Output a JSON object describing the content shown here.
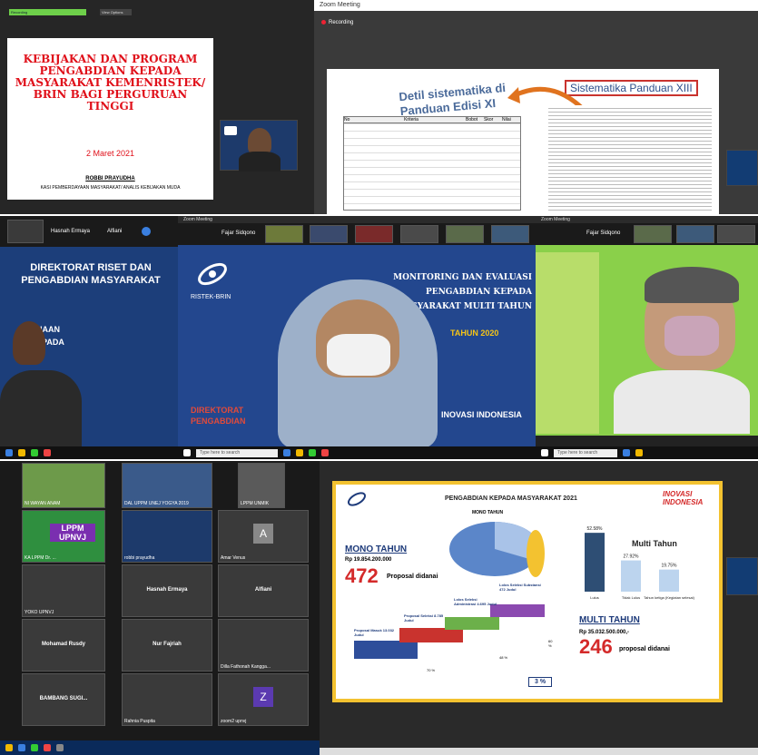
{
  "p1": {
    "topbtn1": "Recording",
    "topbtn2": "View Options",
    "title": "KEBIJAKAN DAN PROGRAM PENGABDIAN KEPADA MASYARAKAT KEMENRISTEK/ BRIN BAGI PERGURUAN TINGGI",
    "date": "2 Maret 2021",
    "presenter": "ROBBI PRAYUDHA",
    "role": "KASI PEMBERDAYAAN MASYARAKAT/ ANALIS KEBIJAKAN MUDA"
  },
  "p2": {
    "zoom_title": "Zoom Meeting",
    "recording": "Recording",
    "callout_left": "Detil sistematika di Panduan Edisi XI",
    "callout_right": "Sistematika Panduan XIII",
    "table_headers": [
      "No",
      "Kriteria",
      "Bobot",
      "Skor",
      "Nilai"
    ]
  },
  "p3": {
    "tile1": "Hasnah Ermaya",
    "tile2": "Alfiani",
    "banner": "DIREKTORAT RISET DAN PENGABDIAN MASYARAKAT",
    "side": "NAAN EPADA"
  },
  "p4": {
    "zoom_title": "Zoom Meeting",
    "presenter": "Fajar Sidqono",
    "slide_title": "MONITORING DAN EVALUASI PENGABDIAN KEPADA MASYARAKAT MULTI TAHUN",
    "year": "TAHUN 2020",
    "brand": "RISTEK-BRIN",
    "footer_left": "DIREKTORAT PENGABDIAN",
    "footer_right": "INOVASI INDONESIA",
    "search": "Type here to search"
  },
  "p5": {
    "zoom_title": "Zoom Meeting",
    "presenter": "Fajar Sidqono",
    "search": "Type here to search"
  },
  "p6": {
    "names": [
      "NI WAYAN ANAM",
      "DAL UPPM UNEJ YOGYA 2019",
      "LPPM UNMIK",
      "KA LPPM Dr. ...",
      "robbi prayudha",
      "Amar Venus",
      "YOKO UPNVJ",
      "Hasnah Ermaya",
      "Alfiani",
      "Mohamad Rusdy",
      "Nur Fajriah",
      "Dilla Fathonah Kangga...",
      "BAMBANG SUGI...",
      "Rahnia Puspita",
      "zoom2 upnvj"
    ],
    "letters": [
      "A",
      "Z"
    ],
    "lppm": "LPPM UPNVJ"
  },
  "p7": {
    "title": "PENGABDIAN KEPADA MASYARAKAT 2021",
    "brand": "INOVASI INDONESIA",
    "mono_title": "MONO TAHUN",
    "mono_amount": "Rp 19.854.200.000",
    "mono_count": "472",
    "mono_label": "Proposal didanai",
    "multi_title": "MULTI TAHUN",
    "multi_amount": "Rp 35.032.500.000,-",
    "multi_count": "246",
    "multi_label": "proposal didanai",
    "funnel": [
      "Proposal Masuk 13.032 Judul",
      "Proposal Seleksi 8.785 Judul",
      "Lolos Seleksi Administrasi 4.695 Judul",
      "Lolos Seleksi Substansi 472 Judul"
    ],
    "funnel_pcts": [
      "70 %",
      "48 %",
      "60 %",
      "3 %"
    ],
    "pie_title": "MONO TAHUN"
  },
  "chart_data": {
    "type": "bar",
    "title": "Multi Tahun",
    "categories": [
      "Lulus",
      "Tidak Lulus",
      "Tahun ketiga (Kegiatan selesai)"
    ],
    "values": [
      52.58,
      27.92,
      19.75
    ],
    "value_labels": [
      "52.58%",
      "27.92%",
      "19.75%"
    ],
    "colors": {
      "bar1": "#2e4e74",
      "bar2": "#bcd4ee",
      "bar3": "#bcd4ee"
    }
  }
}
